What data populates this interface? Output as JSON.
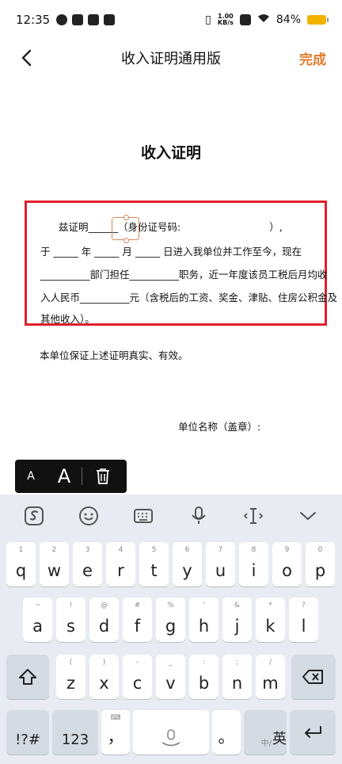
{
  "status_bar": {
    "time": "12:35",
    "net_speed_value": "1.00",
    "net_speed_unit": "KB/s",
    "battery_percent": "84%"
  },
  "nav": {
    "title": "收入证明通用版",
    "done_label": "完成"
  },
  "document": {
    "title": "收入证明",
    "line1_a": "兹证明",
    "line1_blank": "______",
    "line1_b": "（身份证号码:",
    "line1_c": "）,",
    "line2": "于 _____ 年 _____ 月 _____ 日进入我单位并工作至今，现在",
    "line3": "__________部门担任__________职务，近一年度该员工税后月均收",
    "line4": "入人民币__________元（含税后的工资、奖金、津贴、住房公积金及",
    "line5": "其他收入）。",
    "guarantee": "本单位保证上述证明真实、有效。",
    "unit_name": "单位名称（盖章）:"
  },
  "font_toolbar": {
    "small_label": "A",
    "large_label": "A"
  },
  "keyboard": {
    "row1": [
      {
        "main": "q",
        "sec": "1"
      },
      {
        "main": "w",
        "sec": "2"
      },
      {
        "main": "e",
        "sec": "3"
      },
      {
        "main": "r",
        "sec": "4"
      },
      {
        "main": "t",
        "sec": "5"
      },
      {
        "main": "y",
        "sec": "6"
      },
      {
        "main": "u",
        "sec": "7"
      },
      {
        "main": "i",
        "sec": "8"
      },
      {
        "main": "o",
        "sec": "9"
      },
      {
        "main": "p",
        "sec": "0"
      }
    ],
    "row2": [
      {
        "main": "a",
        "sec": "~"
      },
      {
        "main": "s",
        "sec": "!"
      },
      {
        "main": "d",
        "sec": "@"
      },
      {
        "main": "f",
        "sec": "#"
      },
      {
        "main": "g",
        "sec": "%"
      },
      {
        "main": "h",
        "sec": "'"
      },
      {
        "main": "j",
        "sec": "&"
      },
      {
        "main": "k",
        "sec": "*"
      },
      {
        "main": "l",
        "sec": "?"
      }
    ],
    "row3": [
      {
        "main": "z",
        "sec": "("
      },
      {
        "main": "x",
        "sec": ")"
      },
      {
        "main": "c",
        "sec": "-"
      },
      {
        "main": "v",
        "sec": "_"
      },
      {
        "main": "b",
        "sec": ":"
      },
      {
        "main": "n",
        "sec": ";"
      },
      {
        "main": "m",
        "sec": "/"
      }
    ],
    "symbols_label": "!?#",
    "numbers_label": "123",
    "comma_label": "，",
    "period_label": "。",
    "lang_small": "中/",
    "lang_label": "英"
  }
}
